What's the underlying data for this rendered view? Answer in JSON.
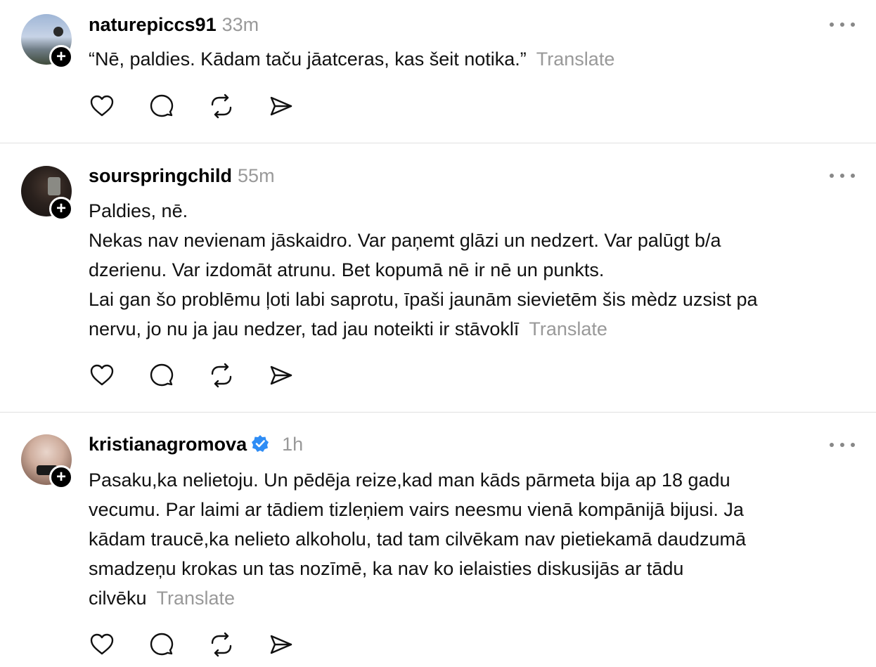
{
  "posts": [
    {
      "username": "naturepiccs91",
      "time": "33m",
      "verified": false,
      "lines": [
        "“Nē, paldies. Kādam taču jāatceras, kas šeit notika.”"
      ],
      "translate": "Translate"
    },
    {
      "username": "sourspringchild",
      "time": "55m",
      "verified": false,
      "lines": [
        "Paldies, nē.",
        "Nekas nav nevienam jāskaidro. Var paņemt glāzi un nedzert. Var palūgt b/a",
        "dzerienu. Var izdomāt atrunu. Bet kopumā nē ir nē un punkts.",
        "Lai gan šo problēmu ļoti labi saprotu, īpaši jaunām sievietēm šis mèdz uzsist pa",
        "nervu, jo nu ja jau nedzer, tad jau noteikti ir stāvoklī"
      ],
      "translate": "Translate"
    },
    {
      "username": "kristianagromova",
      "time": "1h",
      "verified": true,
      "lines": [
        "Pasaku,ka nelietoju. Un pēdēja reize,kad man kāds pārmeta bija ap 18 gadu",
        "vecumu. Par laimi ar tādiem tizleņiem vairs neesmu vienā kompānijā bijusi. Ja",
        "kādam traucē,ka nelieto alkoholu, tad tam cilvēkam nav pietiekamā daudzumā",
        "smadzeņu krokas un tas nozīmē, ka nav ko ielaisties diskusijās ar tādu",
        "cilvēku"
      ],
      "translate": "Translate"
    }
  ],
  "icons": {
    "follow": "plus-icon",
    "more": "more-horizontal-icon",
    "like": "heart-icon",
    "reply": "comment-icon",
    "repost": "repost-icon",
    "share": "send-icon",
    "verified": "verified-badge-icon"
  },
  "colors": {
    "text": "#111111",
    "muted": "#999999",
    "verified": "#2f8df5",
    "divider": "#e0e0e0"
  },
  "badges": {
    "follow_symbol": "+"
  }
}
